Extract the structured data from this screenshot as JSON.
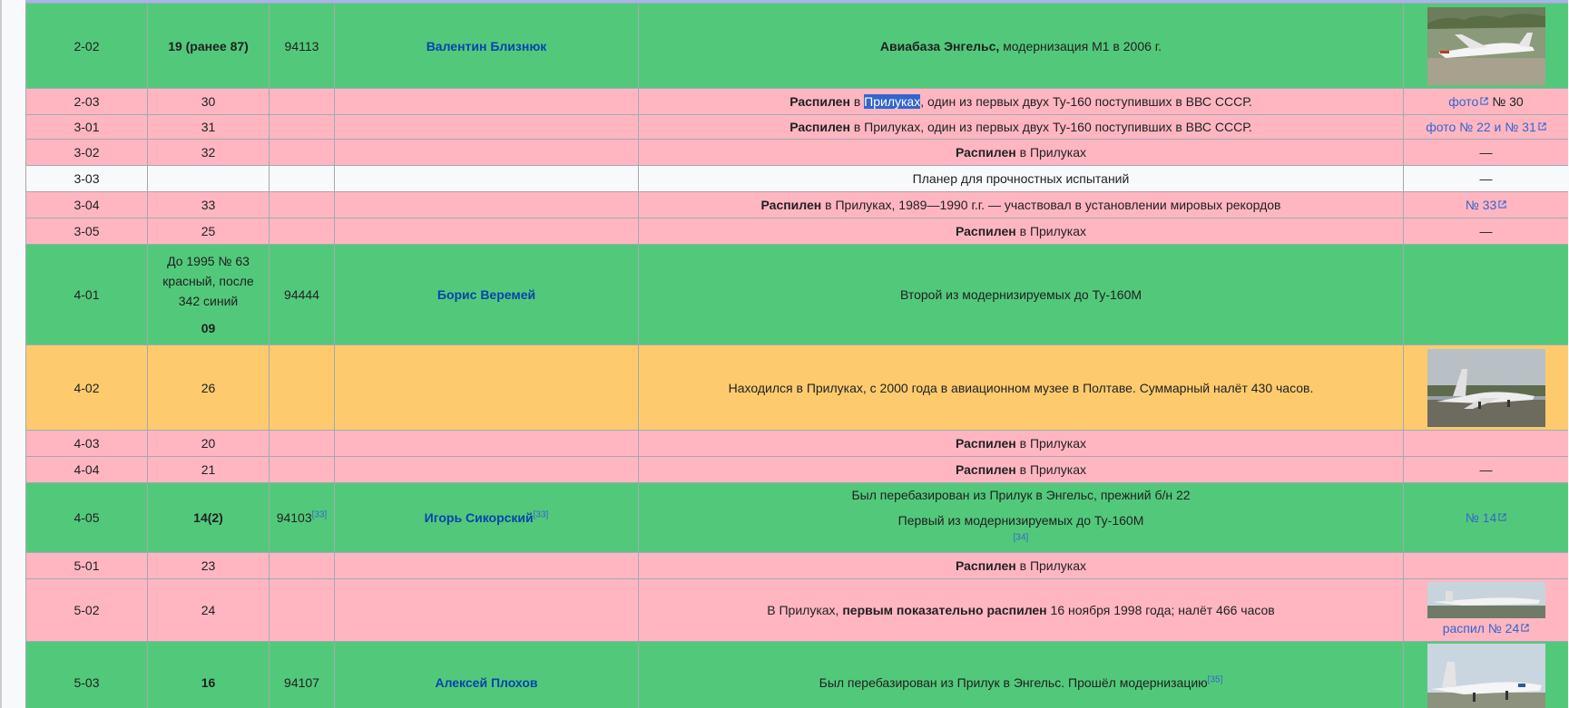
{
  "colors": {
    "green": "#52c97a",
    "pink": "#ffb6c1",
    "orange": "#fdcb6e",
    "white": "#f8f9fa",
    "link": "#3366cc"
  },
  "rows": {
    "r1": {
      "id": "2-02",
      "num": "19 (ранее 87)",
      "reg": "94113",
      "name": "Валентин Близнюк",
      "note_bold": "Авиабаза Энгельс,",
      "note_rest": " модернизация М1 в 2006 г."
    },
    "r2": {
      "id": "2-03",
      "num": "30",
      "note_bold": "Распилен",
      "note_pre": " в ",
      "note_hl": "Прилуках",
      "note_rest": ", один из первых двух Ту-160 поступивших в ВВС СССР.",
      "link": "фото",
      "link_suffix": " № 30"
    },
    "r3": {
      "id": "3-01",
      "num": "31",
      "note_bold": "Распилен",
      "note_rest": " в Прилуках, один из первых двух Ту-160 поступивших в ВВС СССР.",
      "link": "фото № 22 и № 31"
    },
    "r4": {
      "id": "3-02",
      "num": "32",
      "note_bold": "Распилен",
      "note_rest": " в Прилуках",
      "photo": "—"
    },
    "r5": {
      "id": "3-03",
      "note": "Планер для прочностных испытаний",
      "photo": "—"
    },
    "r6": {
      "id": "3-04",
      "num": "33",
      "note_bold": "Распилен",
      "note_rest": " в Прилуках, 1989—1990 г.г. — участвовал в установлении мировых рекордов",
      "link": "№ 33"
    },
    "r7": {
      "id": "3-05",
      "num": "25",
      "note_bold": "Распилен",
      "note_rest": " в Прилуках",
      "photo": "—"
    },
    "r8": {
      "id": "4-01",
      "num_lines": [
        "До 1995 № 63",
        "красный, после",
        "342 синий"
      ],
      "num_bold": "09",
      "reg": "94444",
      "name": "Борис Веремей",
      "note": "Второй из модернизируемых до Ту-160М"
    },
    "r9": {
      "id": "4-02",
      "num": "26",
      "note": "Находился в Прилуках, с 2000 года в авиационном музее в Полтаве. Суммарный налёт 430 часов."
    },
    "r10": {
      "id": "4-03",
      "num": "20",
      "note_bold": "Распилен",
      "note_rest": " в Прилуках"
    },
    "r11": {
      "id": "4-04",
      "num": "21",
      "note_bold": "Распилен",
      "note_rest": " в Прилуках",
      "photo": "—"
    },
    "r12": {
      "id": "4-05",
      "num": "14(2)",
      "reg": "94103",
      "reg_ref": "[33]",
      "name": "Игорь Сикорский",
      "name_ref": "[33]",
      "note1": "Был перебазирован из Прилук в Энгельс, прежний б/н 22",
      "note2": "Первый из модернизируемых до Ту-160М",
      "note2_ref": "[34]",
      "link": "№ 14"
    },
    "r13": {
      "id": "5-01",
      "num": "23",
      "note_bold": "Распилен",
      "note_rest": " в Прилуках"
    },
    "r14": {
      "id": "5-02",
      "num": "24",
      "note_pre": "В Прилуках, ",
      "note_bold": "первым показательно распилен",
      "note_rest": " 16 ноября 1998 года; налёт 466 часов",
      "link": "распил № 24"
    },
    "r15": {
      "id": "5-03",
      "num": "16",
      "reg": "94107",
      "name": "Алексей Плохов",
      "note": "Был перебазирован из Прилук в Энгельс. Прошёл модернизацию",
      "note_ref": "[35]"
    }
  }
}
